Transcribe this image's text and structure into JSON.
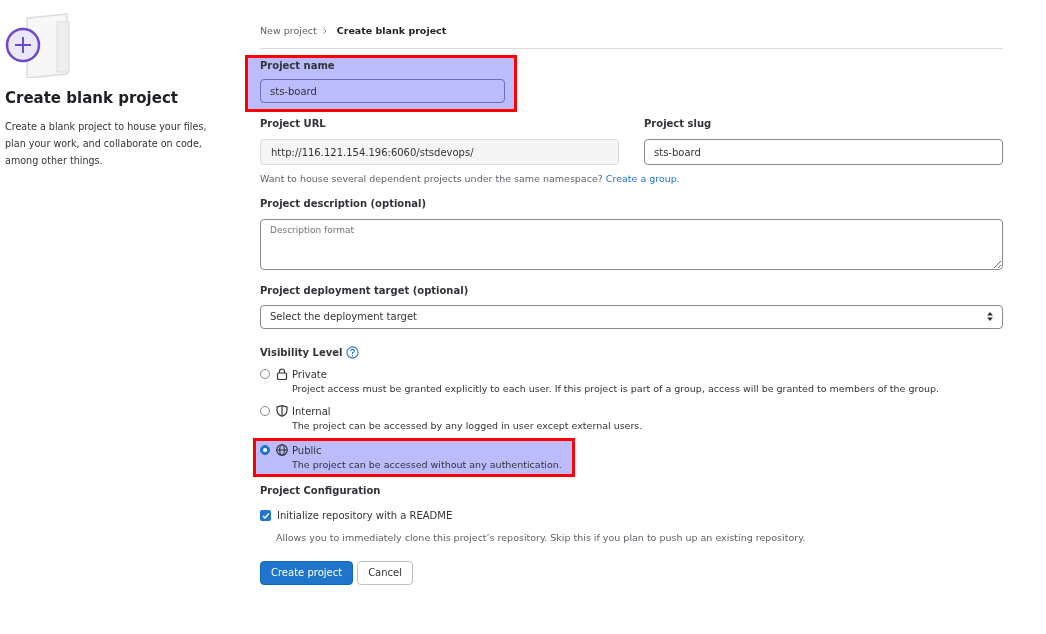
{
  "intro": {
    "title": "Create blank project",
    "description": "Create a blank project to house your files, plan your work, and collaborate on code, among other things."
  },
  "breadcrumb": [
    {
      "label": "New project",
      "current": false
    },
    {
      "label": "Create blank project",
      "current": true
    }
  ],
  "project_name": {
    "label": "Project name",
    "value": "sts-board",
    "highlighted": true
  },
  "project_url": {
    "label": "Project URL",
    "value": "http://116.121.154.196:6060/stsdevops/"
  },
  "project_slug": {
    "label": "Project slug",
    "value": "sts-board"
  },
  "namespace_hint": {
    "text": "Want to house several dependent projects under the same namespace?",
    "link": "Create a group."
  },
  "description": {
    "label": "Project description (optional)",
    "placeholder": "Description format"
  },
  "deployment_target": {
    "label": "Project deployment target (optional)",
    "value": "Select the deployment target"
  },
  "visibility": {
    "label": "Visibility Level",
    "options": [
      {
        "kind": "lock",
        "label": "Private",
        "description": "Project access must be granted explicitly to each user. If this project is part of a group, access will be granted to members of the group.",
        "selected": false,
        "highlighted": false
      },
      {
        "kind": "shield",
        "label": "Internal",
        "description": "The project can be accessed by any logged in user except external users.",
        "selected": false,
        "highlighted": false
      },
      {
        "kind": "globe",
        "label": "Public",
        "description": "The project can be accessed without any authentication.",
        "selected": true,
        "highlighted": true
      }
    ]
  },
  "configuration": {
    "label": "Project Configuration",
    "readme": {
      "label": "Initialize repository with a README",
      "checked": true,
      "help": "Allows you to immediately clone this project’s repository. Skip this if you plan to push up an existing repository."
    }
  },
  "buttons": [
    {
      "kind": "primary",
      "label": "Create project"
    },
    {
      "kind": "secondary",
      "label": "Cancel"
    }
  ]
}
